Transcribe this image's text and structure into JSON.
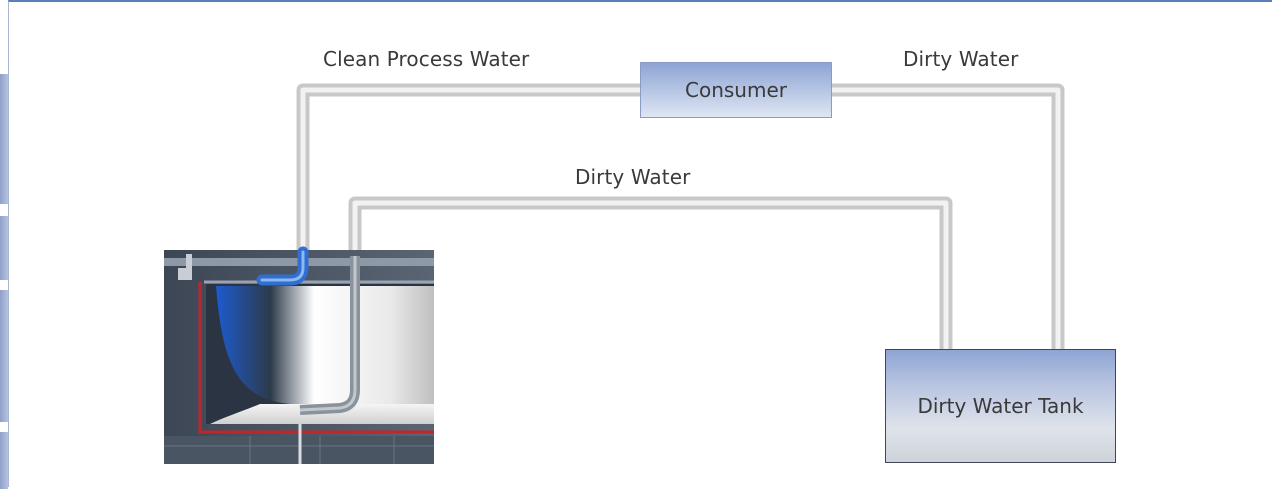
{
  "labels": {
    "clean_process_water": "Clean Process Water",
    "dirty_water_top": "Dirty Water",
    "dirty_water_middle": "Dirty Water"
  },
  "nodes": {
    "consumer": "Consumer",
    "dirty_water_tank": "Dirty Water Tank"
  },
  "colors": {
    "frame_border": "#5a7fb5",
    "box_fill_top": "#8ea4d4",
    "box_fill_bottom": "#dfe6f3",
    "pipe": "#d4d4d4",
    "clean_water": "#3f74d6",
    "machine_body": "#4a5564",
    "basin_liner": "#c0262c"
  }
}
